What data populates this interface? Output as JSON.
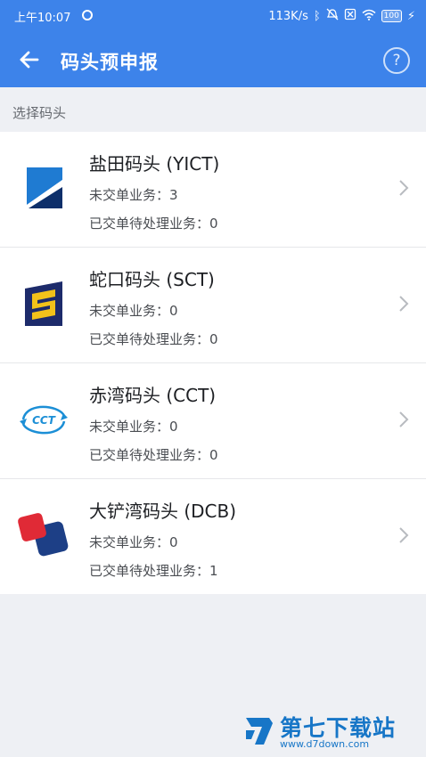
{
  "status_bar": {
    "time": "上午10:07",
    "network_speed": "113K/s",
    "bluetooth_icon": "ᛒ",
    "mute_icon": "mute-icon",
    "sim_icon": "sim-icon",
    "wifi_icon": "wifi-icon",
    "battery": "100",
    "charging_icon": "⚡"
  },
  "app_bar": {
    "title": "码头预申报",
    "back_icon": "←",
    "help_icon": "?"
  },
  "section_label": "选择码头",
  "terminals": [
    {
      "name": "盐田码头 (YICT)",
      "pending_label": "未交单业务：3",
      "submitted_label": "已交单待处理业务：0",
      "logo": "yict-logo"
    },
    {
      "name": "蛇口码头 (SCT)",
      "pending_label": "未交单业务：0",
      "submitted_label": "已交单待处理业务：0",
      "logo": "sct-logo"
    },
    {
      "name": "赤湾码头 (CCT)",
      "pending_label": "未交单业务：0",
      "submitted_label": "已交单待处理业务：0",
      "logo": "cct-logo",
      "logo_text": "CCT"
    },
    {
      "name": "大铲湾码头 (DCB)",
      "pending_label": "未交单业务：0",
      "submitted_label": "已交单待处理业务：1",
      "logo": "dcb-logo"
    }
  ],
  "watermark": {
    "title": "第七下载站",
    "url": "www.d7down.com"
  },
  "colors": {
    "header_blue": "#3d83ea",
    "background": "#eef0f4",
    "watermark_blue": "#1776c7"
  }
}
